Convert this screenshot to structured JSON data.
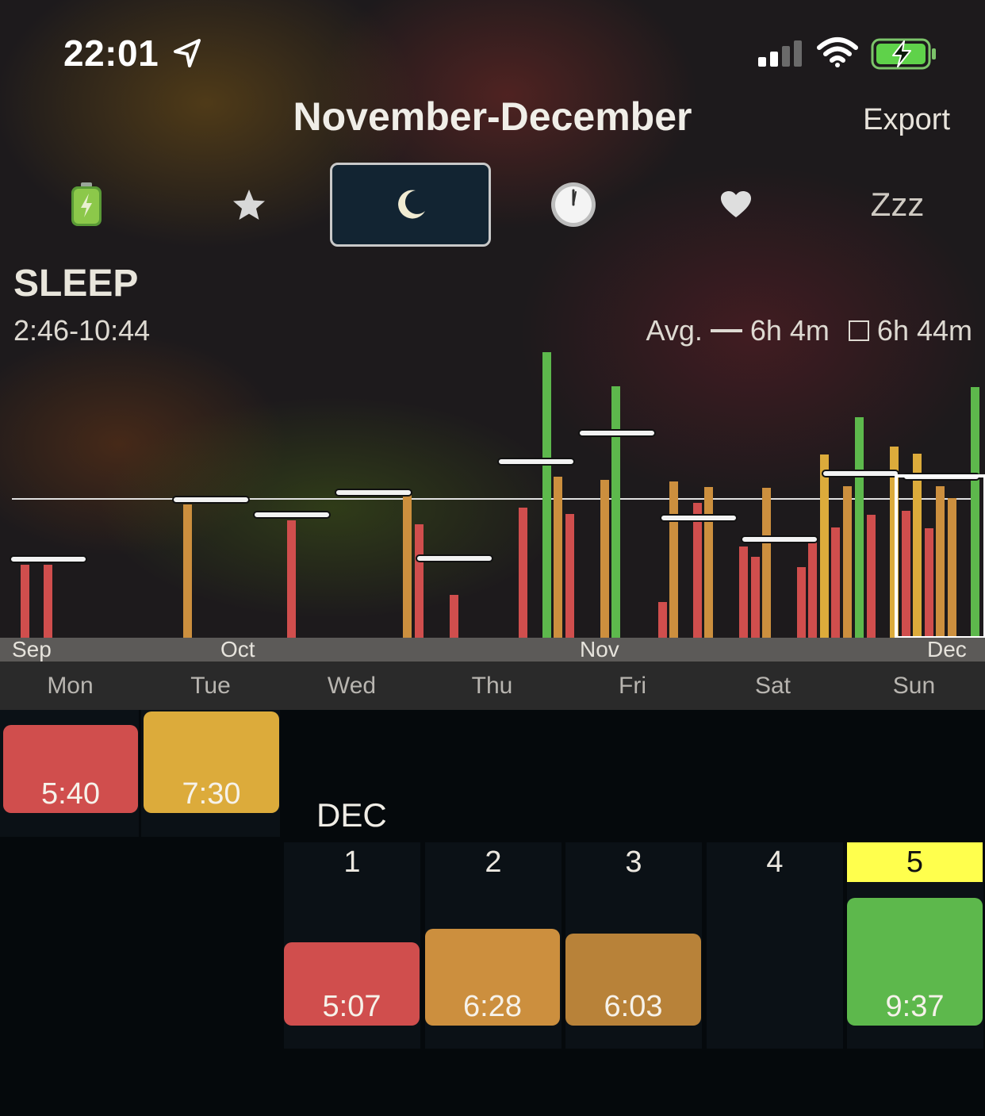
{
  "status_bar": {
    "time": "22:01"
  },
  "header": {
    "title": "November-December",
    "export_label": "Export"
  },
  "tabs": [
    {
      "name": "energy",
      "icon": "battery-icon"
    },
    {
      "name": "rating",
      "icon": "star-icon"
    },
    {
      "name": "sleep",
      "icon": "moon-icon",
      "active": true
    },
    {
      "name": "time",
      "icon": "clock-icon"
    },
    {
      "name": "heart",
      "icon": "heart-icon"
    },
    {
      "name": "zzz",
      "label": "Zzz"
    }
  ],
  "section": {
    "label": "SLEEP",
    "range": "2:46-10:44",
    "avg_label": "Avg.",
    "avg_line_value": "6h 4m",
    "avg_box_value": "6h 44m"
  },
  "chart_data": {
    "type": "bar",
    "months": [
      "Sep",
      "Oct",
      "Nov",
      "Dec"
    ],
    "weekdays": [
      "Mon",
      "Tue",
      "Wed",
      "Thu",
      "Fri",
      "Sat",
      "Sun"
    ],
    "colors": {
      "red": "#d04e4d",
      "orange": "#cc8f3e",
      "yellow": "#dcab3b",
      "green": "#5db84c"
    }
  },
  "calendar": {
    "prev_week": [
      {
        "value": "5:40",
        "color": "#d04e4d"
      },
      {
        "value": "7:30",
        "color": "#dcab3b"
      }
    ],
    "month_label": "DEC",
    "days": [
      {
        "day": "1",
        "value": "5:07",
        "color": "#d04e4d"
      },
      {
        "day": "2",
        "value": "6:28",
        "color": "#cc8f3e"
      },
      {
        "day": "3",
        "value": "6:03",
        "color": "#b88239"
      },
      {
        "day": "4",
        "value": ""
      },
      {
        "day": "5",
        "value": "9:37",
        "color": "#5db84c",
        "today": true
      }
    ],
    "today_highlight": "#ffff4d"
  }
}
